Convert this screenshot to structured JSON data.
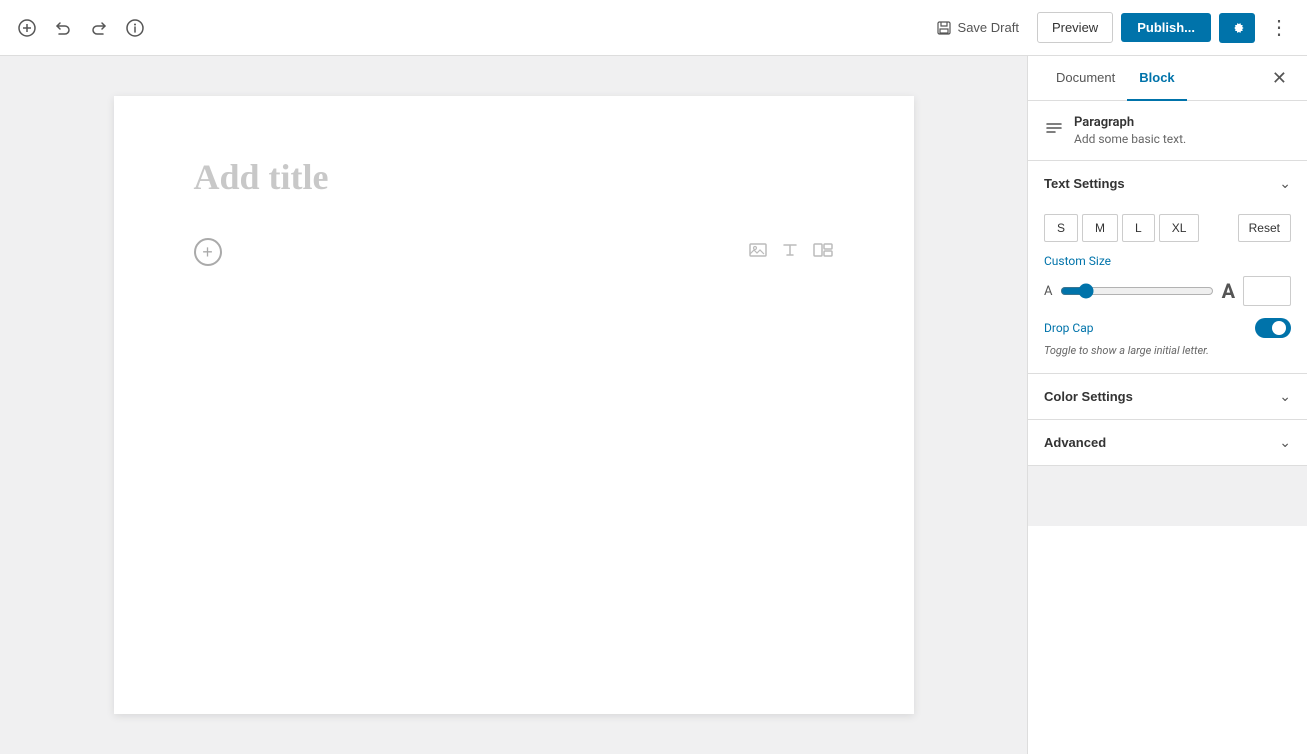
{
  "toolbar": {
    "add_label": "+",
    "undo_label": "↩",
    "redo_label": "↪",
    "info_label": "ℹ",
    "save_draft_label": "Save Draft",
    "preview_label": "Preview",
    "publish_label": "Publish...",
    "settings_label": "⚙",
    "more_label": "⋮"
  },
  "editor": {
    "add_title_placeholder": "Add title",
    "add_block_tooltip": "+"
  },
  "sidebar": {
    "document_tab": "Document",
    "block_tab": "Block",
    "close_label": "✕",
    "block_info": {
      "icon": "≡",
      "title": "Paragraph",
      "description": "Add some basic text."
    },
    "text_settings": {
      "label": "Text Settings",
      "sizes": [
        "S",
        "M",
        "L",
        "XL"
      ],
      "reset_label": "Reset",
      "custom_size_label": "Custom Size",
      "slider_min_label": "A",
      "slider_max_label": "A",
      "drop_cap_label": "Drop Cap",
      "drop_cap_desc": "Toggle to show a large initial letter.",
      "drop_cap_enabled": true
    },
    "color_settings": {
      "label": "Color Settings"
    },
    "advanced": {
      "label": "Advanced"
    }
  }
}
